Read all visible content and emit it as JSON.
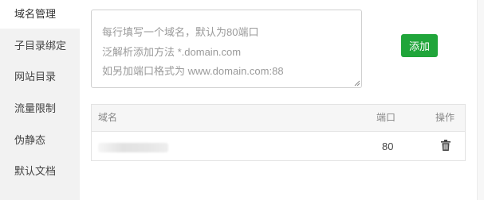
{
  "sidebar": {
    "items": [
      {
        "label": "域名管理",
        "active": true
      },
      {
        "label": "子目录绑定",
        "active": false
      },
      {
        "label": "网站目录",
        "active": false
      },
      {
        "label": "流量限制",
        "active": false
      },
      {
        "label": "伪静态",
        "active": false
      },
      {
        "label": "默认文档",
        "active": false
      }
    ]
  },
  "domain_input": {
    "placeholder_lines": [
      "每行填写一个域名，默认为80端口",
      "泛解析添加方法 *.domain.com",
      "如另加端口格式为 www.domain.com:88"
    ]
  },
  "add_button": {
    "label": "添加",
    "color": "#20a53a"
  },
  "table": {
    "headers": {
      "domain": "域名",
      "port": "端口",
      "action": "操作"
    },
    "rows": [
      {
        "domain": "",
        "port": "80",
        "action_icon": "trash-icon"
      }
    ]
  }
}
